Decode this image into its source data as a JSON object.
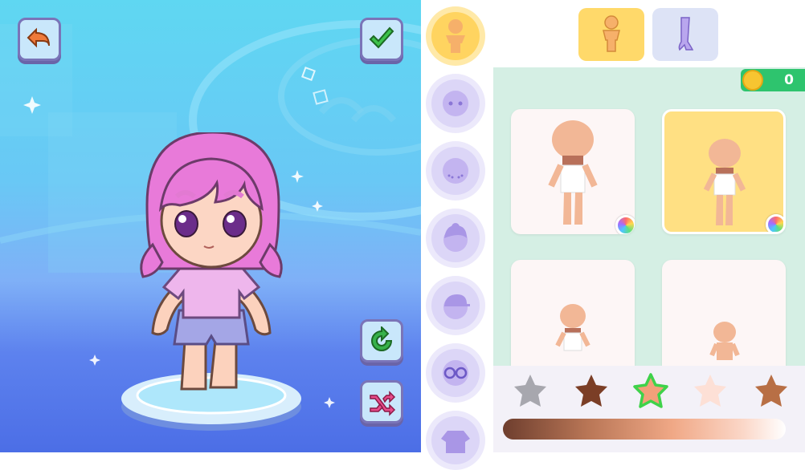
{
  "stage": {
    "back_button": {
      "icon": "back-arrow-icon",
      "color": "#f07a3a"
    },
    "confirm_button": {
      "icon": "checkmark-icon",
      "color": "#3cc24b"
    },
    "reset_button": {
      "icon": "rotate-icon",
      "color": "#37b14b"
    },
    "random_button": {
      "icon": "shuffle-icon",
      "color": "#e84c8a"
    }
  },
  "rail": {
    "items": [
      {
        "name": "body",
        "icon": "body-icon",
        "active": true
      },
      {
        "name": "face",
        "icon": "face-icon",
        "active": false
      },
      {
        "name": "skin-detail",
        "icon": "freckles-icon",
        "active": false
      },
      {
        "name": "hair",
        "icon": "hair-icon",
        "active": false
      },
      {
        "name": "hat",
        "icon": "cap-icon",
        "active": false
      },
      {
        "name": "glasses",
        "icon": "glasses-icon",
        "active": false
      },
      {
        "name": "top",
        "icon": "shirt-icon",
        "active": false
      }
    ]
  },
  "tabs": [
    {
      "name": "body-tab",
      "icon": "body-icon",
      "active": true
    },
    {
      "name": "limb-tab",
      "icon": "arm-icon",
      "active": false
    }
  ],
  "coins": {
    "count": "0"
  },
  "cards": [
    {
      "name": "body-type-1",
      "selected": false,
      "has_color": true
    },
    {
      "name": "body-type-2",
      "selected": true,
      "has_color": true
    },
    {
      "name": "body-type-3",
      "selected": false,
      "has_color": false
    },
    {
      "name": "body-type-4",
      "selected": false,
      "has_color": false
    }
  ],
  "skin_colors": [
    "#a7a7ae",
    "#7b3e26",
    "#f3a07a",
    "#fde0d6",
    "#b86f45"
  ],
  "selected_skin_color": 2,
  "colors": {
    "accent": "#ffd460",
    "panel_bg": "#d5efe4",
    "rail_bg": "#ece9fb",
    "coin_bg": "#2ec46e"
  }
}
